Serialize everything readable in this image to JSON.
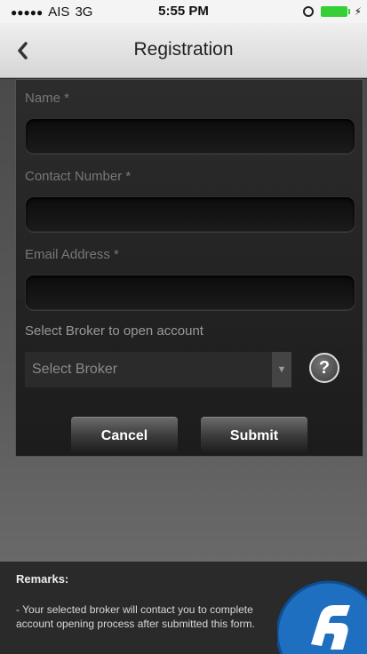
{
  "status_bar": {
    "carrier": "AIS",
    "network": "3G",
    "time": "5:55 PM"
  },
  "nav": {
    "back_label": "<",
    "title": "Registration"
  },
  "form": {
    "name_label": "Name *",
    "name_value": "",
    "contact_label": "Contact Number *",
    "contact_value": "",
    "email_label": "Email Address *",
    "email_value": "",
    "broker_label": "Select Broker to open account",
    "broker_selected": "Select Broker",
    "help_label": "?",
    "cancel_label": "Cancel",
    "submit_label": "Submit"
  },
  "remarks": {
    "title": "Remarks:",
    "text": "- Your selected broker will contact you to complete account opening process after submitted this form."
  },
  "colors": {
    "battery": "#35d038",
    "logo_blue": "#1f6fc0"
  },
  "icons": [
    "back-chevron-icon",
    "orientation-lock-icon",
    "battery-icon",
    "help-icon",
    "dropdown-arrow-icon",
    "broker-logo"
  ]
}
